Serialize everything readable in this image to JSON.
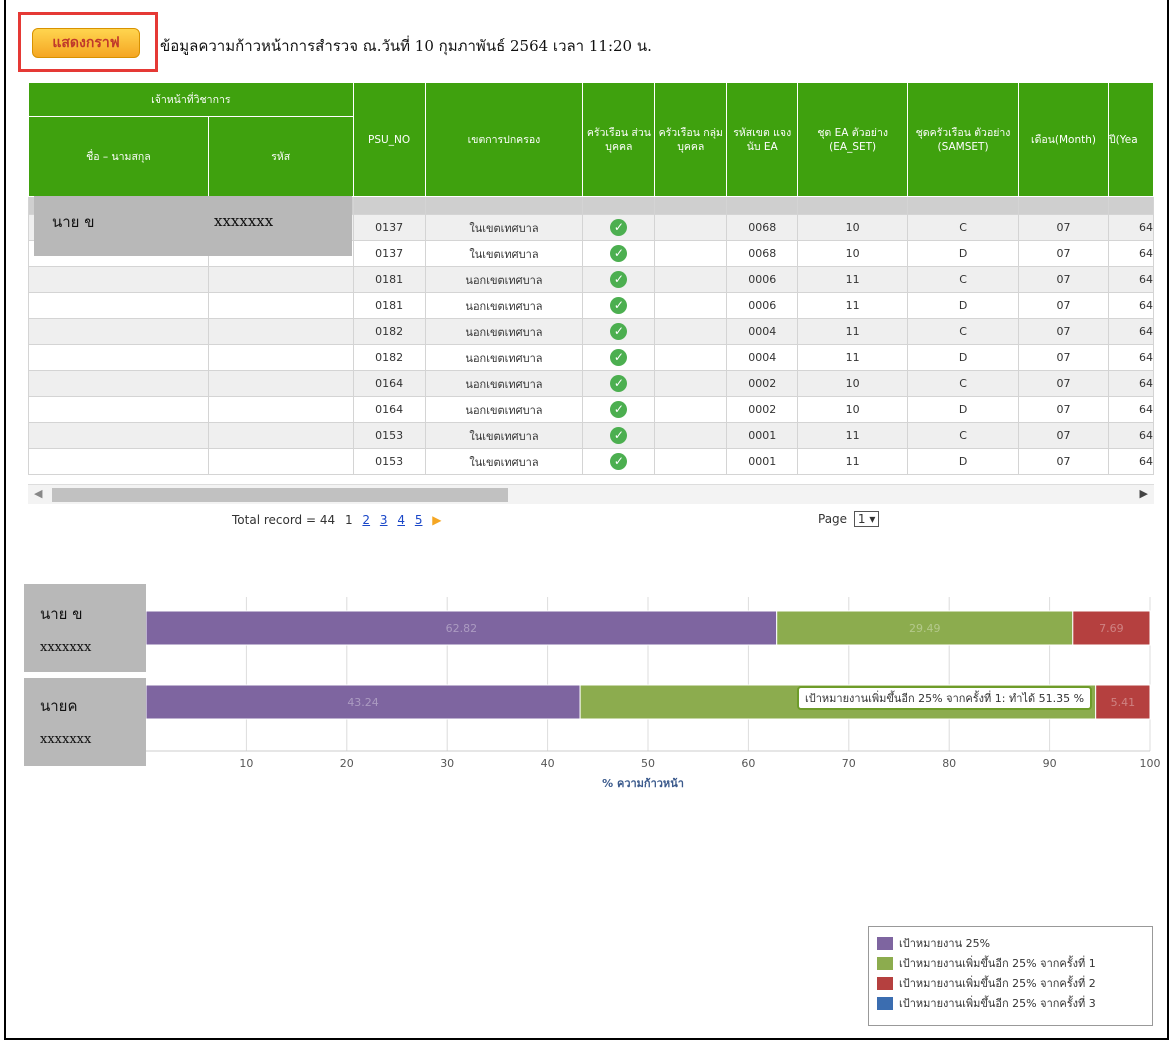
{
  "toolbar": {
    "show_graph_label": "แสดงกราฟ",
    "header_text": "ข้อมูลความก้าวหน้าการสำรวจ ณ.วันที่ 10 กุมภาพันธ์ 2564 เวลา 11:20 น."
  },
  "grid": {
    "group_header": "เจ้าหน้าที่วิชาการ",
    "columns": {
      "name": "ชื่อ – นามสกุล",
      "code": "รหัส",
      "psu_no": "PSU_NO",
      "admin_area": "เขตการปกครอง",
      "hh_private": "ครัวเรือน ส่วนบุคคล",
      "hh_group": "ครัวเรือน กลุ่มบุคคล",
      "ea_code": "รหัสเขต แจงนับ EA",
      "ea_set": "ชุด EA ตัวอย่าง (EA_SET)",
      "samset": "ชุดครัวเรือน ตัวอย่าง (SAMSET)",
      "month": "เดือน(Month)",
      "year": "ปี(Yea"
    },
    "rows": [
      {
        "psu": "0137",
        "area": "ในเขตเทศบาล",
        "ea": "0068",
        "set": "10",
        "sam": "C",
        "month": "07",
        "year": "64"
      },
      {
        "psu": "0137",
        "area": "ในเขตเทศบาล",
        "ea": "0068",
        "set": "10",
        "sam": "D",
        "month": "07",
        "year": "64"
      },
      {
        "psu": "0181",
        "area": "นอกเขตเทศบาล",
        "ea": "0006",
        "set": "11",
        "sam": "C",
        "month": "07",
        "year": "64"
      },
      {
        "psu": "0181",
        "area": "นอกเขตเทศบาล",
        "ea": "0006",
        "set": "11",
        "sam": "D",
        "month": "07",
        "year": "64"
      },
      {
        "psu": "0182",
        "area": "นอกเขตเทศบาล",
        "ea": "0004",
        "set": "11",
        "sam": "C",
        "month": "07",
        "year": "64"
      },
      {
        "psu": "0182",
        "area": "นอกเขตเทศบาล",
        "ea": "0004",
        "set": "11",
        "sam": "D",
        "month": "07",
        "year": "64"
      },
      {
        "psu": "0164",
        "area": "นอกเขตเทศบาล",
        "ea": "0002",
        "set": "10",
        "sam": "C",
        "month": "07",
        "year": "64"
      },
      {
        "psu": "0164",
        "area": "นอกเขตเทศบาล",
        "ea": "0002",
        "set": "10",
        "sam": "D",
        "month": "07",
        "year": "64"
      },
      {
        "psu": "0153",
        "area": "ในเขตเทศบาล",
        "ea": "0001",
        "set": "11",
        "sam": "C",
        "month": "07",
        "year": "64"
      },
      {
        "psu": "0153",
        "area": "ในเขตเทศบาล",
        "ea": "0001",
        "set": "11",
        "sam": "D",
        "month": "07",
        "year": "64"
      }
    ]
  },
  "pager": {
    "total": "Total record = 44",
    "current": "1",
    "pages": [
      "2",
      "3",
      "4",
      "5"
    ],
    "next": "▶",
    "page_label": "Page",
    "page_value": "1"
  },
  "overlays": {
    "table_name": "นาย ข",
    "table_code": "xxxxxxx",
    "chart_name1": "นาย ข",
    "chart_code1": "xxxxxxx",
    "chart_name2": "นายค",
    "chart_code2": "xxxxxxx"
  },
  "tooltip": "เป้าหมายงานเพิ่มขึ้นอีก 25% จากครั้งที่ 1: ทำได้ 51.35 %",
  "colors": {
    "header_green": "#3fa10e",
    "series": [
      "#7e65a0",
      "#8cac4e",
      "#b5403f",
      "#3b6db0"
    ]
  },
  "chart_data": {
    "type": "bar",
    "orientation": "horizontal",
    "stacked": true,
    "xlabel": "% ความก้าวหน้า",
    "xlim": [
      0,
      100
    ],
    "xticks": [
      "10",
      "20",
      "30",
      "40",
      "50",
      "60",
      "70",
      "80",
      "90",
      "100"
    ],
    "categories": [
      "นาย ข xxxxxxx",
      "นายค xxxxxxx"
    ],
    "series": [
      {
        "name": "เป้าหมายงาน 25%",
        "values": [
          62.82,
          43.24
        ]
      },
      {
        "name": "เป้าหมายงานเพิ่มขึ้นอีก 25% จากครั้งที่ 1",
        "values": [
          29.49,
          51.35
        ]
      },
      {
        "name": "เป้าหมายงานเพิ่มขึ้นอีก 25% จากครั้งที่ 2",
        "values": [
          7.69,
          5.41
        ]
      },
      {
        "name": "เป้าหมายงานเพิ่มขึ้นอีก 25% จากครั้งที่ 3",
        "values": [
          0,
          0
        ]
      }
    ],
    "data_labels": [
      [
        "62.82",
        "29.49",
        "7.69",
        "0"
      ],
      [
        "43.24",
        "51.35",
        "5.41",
        "0"
      ]
    ],
    "grid": true,
    "legend_position": "bottom-right"
  }
}
